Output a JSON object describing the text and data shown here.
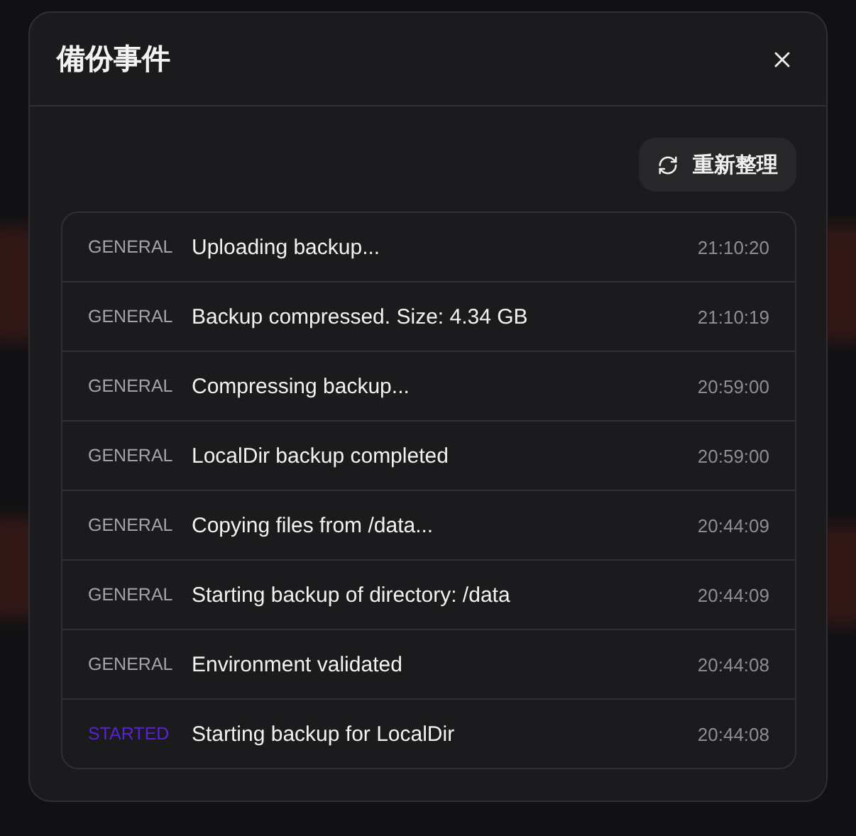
{
  "dialog": {
    "title": "備份事件",
    "refresh_button": "重新整理"
  },
  "events": [
    {
      "kind": "general",
      "type_label": "GENERAL",
      "message": "Uploading backup...",
      "time": "21:10:20"
    },
    {
      "kind": "general",
      "type_label": "GENERAL",
      "message": "Backup compressed. Size: 4.34 GB",
      "time": "21:10:19"
    },
    {
      "kind": "general",
      "type_label": "GENERAL",
      "message": "Compressing backup...",
      "time": "20:59:00"
    },
    {
      "kind": "general",
      "type_label": "GENERAL",
      "message": "LocalDir backup completed",
      "time": "20:59:00"
    },
    {
      "kind": "general",
      "type_label": "GENERAL",
      "message": "Copying files from /data...",
      "time": "20:44:09"
    },
    {
      "kind": "general",
      "type_label": "GENERAL",
      "message": "Starting backup of directory: /data",
      "time": "20:44:09"
    },
    {
      "kind": "general",
      "type_label": "GENERAL",
      "message": "Environment validated",
      "time": "20:44:08"
    },
    {
      "kind": "started",
      "type_label": "STARTED",
      "message": "Starting backup for LocalDir",
      "time": "20:44:08"
    }
  ]
}
